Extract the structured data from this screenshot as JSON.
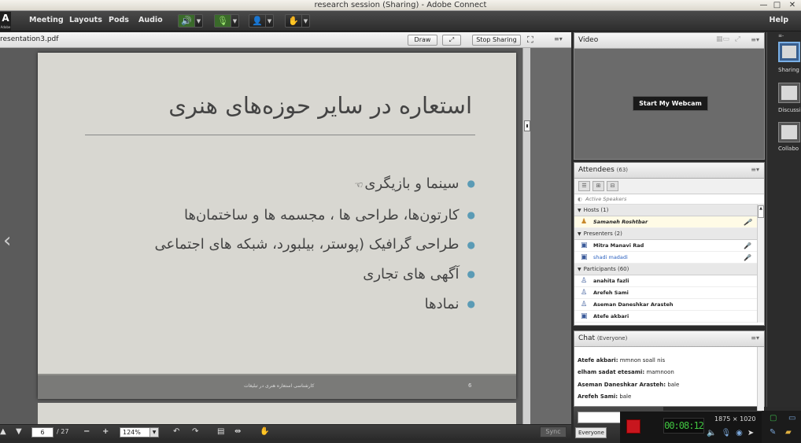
{
  "window": {
    "title": "research session (Sharing) - Adobe Connect",
    "minimize": "—",
    "maximize": "□",
    "close": "✕"
  },
  "menubar": {
    "logo": "A",
    "logo_text": "Adobe",
    "items": [
      "Meeting",
      "Layouts",
      "Pods",
      "Audio"
    ],
    "help": "Help"
  },
  "share_pod": {
    "file_name": "resentation3.pdf",
    "draw_label": "Draw",
    "stop_sharing_label": "Stop Sharing",
    "menu_icon": "≡▾"
  },
  "slide": {
    "title": "استعاره در سایر حوزه‌های هنری",
    "bullets": [
      "سینما و بازیگری",
      "کارتون‌ها، طراحی ها ، مجسمه ها و ساختمان‌ها",
      "طراحی گرافیک (پوستر، بیلبورد، شبکه های اجتماعی",
      "آگهی های تجاری",
      "نمادها"
    ],
    "footer_text": "کارشناسی استعاره هنری در تبلیغات",
    "page_number": "6"
  },
  "bottombar": {
    "current_page": "6",
    "total_pages": "/ 27",
    "zoom": "124%",
    "sync_label": "Sync"
  },
  "video_pod": {
    "title": "Video",
    "webcam_label": "Start My Webcam"
  },
  "attendees_pod": {
    "title": "Attendees",
    "count": "(63)",
    "active_speakers": "Active Speakers",
    "groups": [
      {
        "label": "Hosts (1)",
        "members": [
          {
            "name": "Samaneh Roshtbar",
            "mic": true,
            "style": "hl ital"
          }
        ]
      },
      {
        "label": "Presenters (2)",
        "members": [
          {
            "name": "Mitra Manavi Rad",
            "mic": true,
            "style": ""
          },
          {
            "name": "shadi madadi",
            "mic": true,
            "style": "blue"
          }
        ]
      },
      {
        "label": "Participants (60)",
        "members": [
          {
            "name": "anahita fazli",
            "mic": false,
            "style": ""
          },
          {
            "name": "Arefeh Sami",
            "mic": false,
            "style": ""
          },
          {
            "name": "Aseman Daneshkar Arasteh",
            "mic": false,
            "style": ""
          },
          {
            "name": "Atefe akbari",
            "mic": false,
            "style": ""
          }
        ]
      }
    ]
  },
  "chat_pod": {
    "title": "Chat",
    "scope": "(Everyone)",
    "messages": [
      {
        "sender": "Atefe akbari:",
        "text": " mmnon soall nis"
      },
      {
        "sender": "elham sadat etesami:",
        "text": " mamnoon"
      },
      {
        "sender": "Aseman Daneshkar Arasteh:",
        "text": " bale"
      },
      {
        "sender": "Arefeh Sami:",
        "text": " bale"
      }
    ],
    "recipient": "Everyone"
  },
  "recorder": {
    "time": "00:08:12",
    "resolution": "1875 × 1020"
  },
  "layouts_tray": {
    "items": [
      "Sharing",
      "Discussi",
      "Collabo"
    ]
  }
}
